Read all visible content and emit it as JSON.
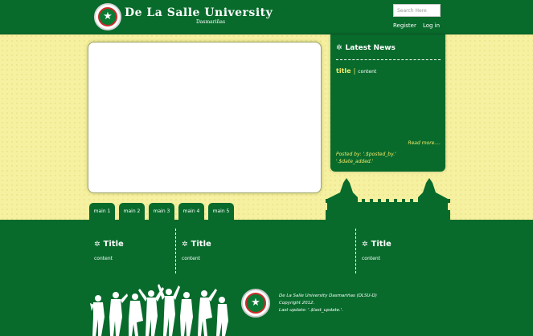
{
  "header": {
    "logo_text": "De La Salle University",
    "logo_sub": "Dasmariñas",
    "search": {
      "placeholder": "Search Here",
      "value": ""
    },
    "nav": {
      "register": "Register",
      "login": "Log in"
    }
  },
  "news": {
    "heading": "Latest News",
    "item": {
      "title": "title",
      "separator": "|",
      "content": "content"
    },
    "read_more": "Read more....",
    "posted_by": "Posted by: '.$posted_by.'",
    "date_added": "'.$date_added.'"
  },
  "tabs": [
    {
      "label": "main 1"
    },
    {
      "label": "main 2"
    },
    {
      "label": "main 3"
    },
    {
      "label": "main 4"
    },
    {
      "label": "main 5"
    }
  ],
  "footer": {
    "columns": [
      {
        "title": "Title",
        "content": "content"
      },
      {
        "title": "Title",
        "content": "content"
      },
      {
        "title": "Title",
        "content": "content"
      }
    ],
    "info": {
      "line1": "De La Salle University Dasmariñas (DLSU-D)",
      "line2": "Copyright 2012.",
      "line3": "Last update: '.$last_update.'."
    }
  },
  "colors": {
    "green": "#086b2c",
    "yellow_bg": "#f6f1a0",
    "accent_yellow": "#f4e96a"
  }
}
